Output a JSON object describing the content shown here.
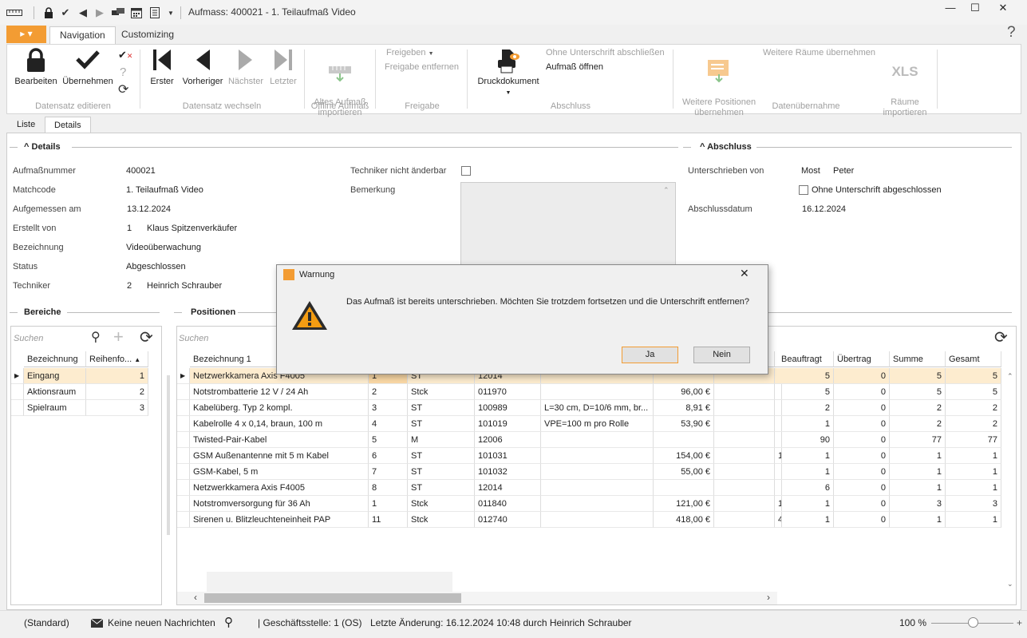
{
  "window": {
    "title": "Aufmass: 400021 - 1. Teilaufmaß Video",
    "minimize": "—",
    "maximize": "☐",
    "close": "✕"
  },
  "tabs": {
    "app": "▸ ▾",
    "navigation": "Navigation",
    "customizing": "Customizing",
    "help": "?"
  },
  "ribbon": {
    "bearbeiten": "Bearbeiten",
    "uebernehmen": "Übernehmen",
    "grp_datensatz_editieren": "Datensatz editieren",
    "erster": "Erster",
    "vorheriger": "Vorheriger",
    "naechster": "Nächster",
    "letzter": "Letzter",
    "grp_datensatz_wechseln": "Datensatz wechseln",
    "altes_aufmass": "Altes Aufmaß\nimportieren",
    "grp_offline": "Offline Aufmaß",
    "freigeben": "Freigeben",
    "freigabe_entfernen": "Freigabe entfernen",
    "grp_freigabe": "Freigabe",
    "druckdokument": "Druckdokument",
    "ohne_unterschrift": "Ohne Unterschrift abschließen",
    "aufmass_oeffnen": "Aufmaß öffnen",
    "grp_abschluss": "Abschluss",
    "weitere_positionen": "Weitere Positionen\nübernehmen",
    "weitere_raeume": "Weitere Räume übernehmen",
    "raeume_importieren": "Räume\nimportieren",
    "xls": "XLS",
    "grp_datenuebernahme": "Datenübernahme"
  },
  "view_tabs": {
    "liste": "Liste",
    "details": "Details"
  },
  "details": {
    "section": "Details",
    "aufmassnummer_label": "Aufmaßnummer",
    "aufmassnummer": "400021",
    "matchcode_label": "Matchcode",
    "matchcode": "1. Teilaufmaß Video",
    "aufgemessen_label": "Aufgemessen am",
    "aufgemessen": "13.12.2024",
    "erstellt_label": "Erstellt von",
    "erstellt_nr": "1",
    "erstellt_name": "Klaus Spitzenverkäufer",
    "bezeichnung_label": "Bezeichnung",
    "bezeichnung": "Videoüberwachung",
    "status_label": "Status",
    "status": "Abgeschlossen",
    "techniker_label": "Techniker",
    "techniker_nr": "2",
    "techniker_name": "Heinrich Schrauber",
    "techniker_fix_label": "Techniker nicht änderbar",
    "bemerkung_label": "Bemerkung"
  },
  "abschluss": {
    "section": "Abschluss",
    "unterschrieben_label": "Unterschrieben von",
    "vorname": "Most",
    "nachname": "Peter",
    "ohne_label": "Ohne Unterschrift abgeschlossen",
    "datum_label": "Abschlussdatum",
    "datum": "16.12.2024"
  },
  "bereiche": {
    "section": "Bereiche",
    "search_placeholder": "Suchen",
    "columns": [
      "Bezeichnung",
      "Reihenfo..."
    ],
    "rows": [
      [
        "Eingang",
        "1"
      ],
      [
        "Aktionsraum",
        "2"
      ],
      [
        "Spielraum",
        "3"
      ]
    ]
  },
  "positionen": {
    "section": "Positionen",
    "search_placeholder": "Suchen",
    "columns": [
      "Bezeichnung 1",
      "",
      "",
      "",
      "",
      "",
      "",
      "",
      "Beauftragt",
      "Übertrag",
      "Summe",
      "Gesamt"
    ],
    "rows": [
      [
        "Netzwerkkamera Axis F4005",
        "1",
        "ST",
        "12014",
        "",
        "",
        "",
        "",
        "5",
        "0",
        "5",
        "5"
      ],
      [
        "Notstrombatterie 12 V / 24 Ah",
        "2",
        "Stck",
        "011970",
        "",
        "96,00 €",
        "",
        "",
        "5",
        "0",
        "5",
        "5"
      ],
      [
        "Kabelüberg. Typ 2 kompl.",
        "3",
        "ST",
        "100989",
        "L=30 cm, D=10/6 mm, br...",
        "8,91 €",
        "",
        "",
        "2",
        "0",
        "2",
        "2"
      ],
      [
        "Kabelrolle 4 x 0,14, braun, 100 m",
        "4",
        "ST",
        "101019",
        "VPE=100 m pro Rolle",
        "53,90 €",
        "",
        "",
        "1",
        "0",
        "2",
        "2"
      ],
      [
        "Twisted-Pair-Kabel",
        "5",
        "M",
        "12006",
        "",
        "",
        "",
        "",
        "90",
        "0",
        "77",
        "77"
      ],
      [
        "GSM Außenantenne mit 5 m Kabel",
        "6",
        "ST",
        "101031",
        "",
        "154,00 €",
        "",
        "1",
        "1",
        "0",
        "1",
        "1"
      ],
      [
        "GSM-Kabel, 5 m",
        "7",
        "ST",
        "101032",
        "",
        "55,00 €",
        "",
        "",
        "1",
        "0",
        "1",
        "1"
      ],
      [
        "Netzwerkkamera Axis F4005",
        "8",
        "ST",
        "12014",
        "",
        "",
        "",
        "",
        "6",
        "0",
        "1",
        "1"
      ],
      [
        "Notstromversorgung für 36 Ah",
        "1",
        "Stck",
        "011840",
        "",
        "121,00 €",
        "",
        "1",
        "1",
        "0",
        "3",
        "3"
      ],
      [
        "Sirenen u. Blitzleuchteneinheit PAP",
        "11",
        "Stck",
        "012740",
        "",
        "418,00 €",
        "",
        "4",
        "1",
        "0",
        "1",
        "1"
      ]
    ]
  },
  "dialog": {
    "title": "Warnung",
    "message": "Das Aufmaß ist bereits unterschrieben. Möchten Sie trotzdem fortsetzen und die Unterschrift entfernen?",
    "yes": "Ja",
    "no": "Nein",
    "close": "✕"
  },
  "statusbar": {
    "profile": "(Standard)",
    "messages": "Keine neuen Nachrichten",
    "branch": "| Geschäftsstelle:  1 (OS)",
    "last_change": "Letzte Änderung: 16.12.2024 10:48 durch Heinrich Schrauber",
    "zoom": "100 %",
    "zoom_level": 100
  },
  "colors": {
    "accent": "#f39c33",
    "selected_row": "#fdeccf",
    "warning": "#f39c12"
  }
}
